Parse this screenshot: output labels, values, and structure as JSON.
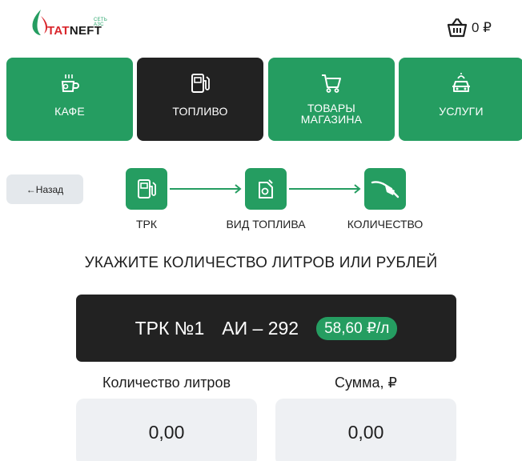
{
  "header": {
    "logo_small": "СЕТЬ АЗС",
    "logo_text_part1": "TAT",
    "logo_text_part2": "NEFT",
    "cart_amount": "0 ₽"
  },
  "categories": [
    {
      "label": "КАФЕ",
      "icon": "coffee-cup-icon",
      "active": false
    },
    {
      "label": "ТОПЛИВО",
      "icon": "fuel-pump-icon",
      "active": true
    },
    {
      "label": "ТОВАРЫ\nМАГАЗИНА",
      "label_line1": "ТОВАРЫ",
      "label_line2": "МАГАЗИНА",
      "icon": "shopping-cart-icon",
      "active": false
    },
    {
      "label": "УСЛУГИ",
      "icon": "car-wash-icon",
      "active": false
    }
  ],
  "back_button": "←Назад",
  "steps": [
    {
      "label": "ТРК",
      "icon": "fuel-pump-icon"
    },
    {
      "label": "ВИД ТОПЛИВА",
      "icon": "fuel-can-icon"
    },
    {
      "label": "КОЛИЧЕСТВО",
      "icon": "fuel-nozzle-icon"
    }
  ],
  "instruction": "УКАЖИТЕ КОЛИЧЕСТВО ЛИТРОВ ИЛИ РУБЛЕЙ",
  "pump": {
    "number": "ТРК №1",
    "fuel": "АИ – 292",
    "price": "58,60 ₽/л"
  },
  "liters": {
    "label": "Количество литров",
    "value": "0,00"
  },
  "sum": {
    "label": "Сумма, ₽",
    "value": "0,00"
  },
  "colors": {
    "accent": "#259d61",
    "dark": "#222222",
    "field_bg": "#eef0f3",
    "brand_red": "#d9262c"
  }
}
